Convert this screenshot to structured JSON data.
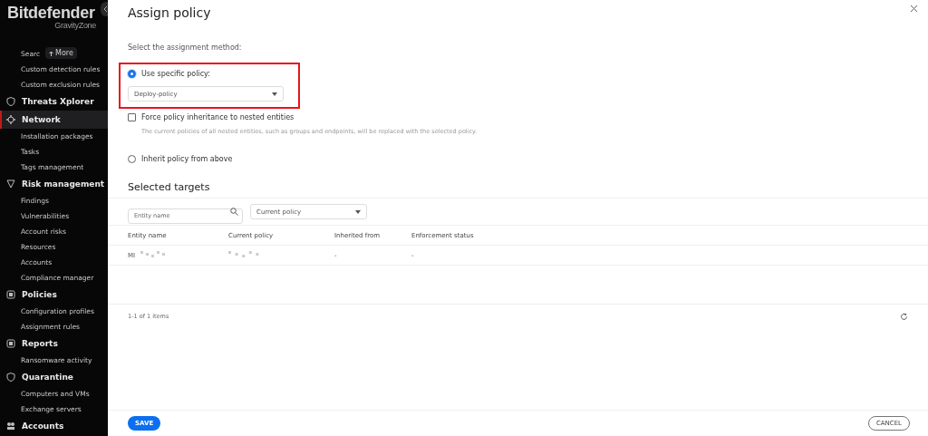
{
  "sidebar": {
    "logo": "Bitdefender",
    "logo_sub": "GravityZone",
    "more_badge": "More",
    "items": [
      {
        "kind": "sub",
        "label": "Searc",
        "selected": false
      },
      {
        "kind": "sub",
        "label": "Custom detection rules",
        "selected": false
      },
      {
        "kind": "sub",
        "label": "Custom exclusion rules",
        "selected": false
      },
      {
        "kind": "section",
        "label": "Threats Xplorer",
        "selected": false
      },
      {
        "kind": "section",
        "label": "Network",
        "selected": true
      },
      {
        "kind": "sub",
        "label": "Installation packages",
        "selected": false
      },
      {
        "kind": "sub",
        "label": "Tasks",
        "selected": false
      },
      {
        "kind": "sub",
        "label": "Tags management",
        "selected": false
      },
      {
        "kind": "section",
        "label": "Risk management",
        "selected": false
      },
      {
        "kind": "sub",
        "label": "Findings",
        "selected": false
      },
      {
        "kind": "sub",
        "label": "Vulnerabilities",
        "selected": false
      },
      {
        "kind": "sub",
        "label": "Account risks",
        "selected": false
      },
      {
        "kind": "sub",
        "label": "Resources",
        "selected": false
      },
      {
        "kind": "sub",
        "label": "Accounts",
        "selected": false
      },
      {
        "kind": "sub",
        "label": "Compliance manager",
        "selected": false
      },
      {
        "kind": "section",
        "label": "Policies",
        "selected": false
      },
      {
        "kind": "sub",
        "label": "Configuration profiles",
        "selected": false
      },
      {
        "kind": "sub",
        "label": "Assignment rules",
        "selected": false
      },
      {
        "kind": "section",
        "label": "Reports",
        "selected": false
      },
      {
        "kind": "sub",
        "label": "Ransomware activity",
        "selected": false
      },
      {
        "kind": "section",
        "label": "Quarantine",
        "selected": false
      },
      {
        "kind": "sub",
        "label": "Computers and VMs",
        "selected": false
      },
      {
        "kind": "sub",
        "label": "Exchange servers",
        "selected": false
      },
      {
        "kind": "section",
        "label": "Accounts",
        "selected": false
      }
    ]
  },
  "dialog": {
    "title": "Assign policy",
    "method_label": "Select the assignment method:",
    "specific": {
      "label": "Use specific policy:",
      "selected": true,
      "policy": "Deploy-policy"
    },
    "force": {
      "label": "Force policy inheritance to nested entities",
      "checked": false,
      "note": "The current policies of all nested entities, such as groups and endpoints, will be replaced with the selected policy."
    },
    "inherit": {
      "label": "Inherit policy from above",
      "selected": false
    },
    "targets_title": "Selected targets",
    "filters": {
      "entity_placeholder": "Entity name",
      "policy_placeholder": "Current policy"
    },
    "columns": [
      "Entity name",
      "Current policy",
      "Inherited from",
      "Enforcement status"
    ],
    "rows": [
      {
        "entity": "MI",
        "inherited": "-",
        "enforcement": "-"
      }
    ],
    "pager": "1-1 of 1 items",
    "save": "SAVE",
    "cancel": "CANCEL"
  }
}
